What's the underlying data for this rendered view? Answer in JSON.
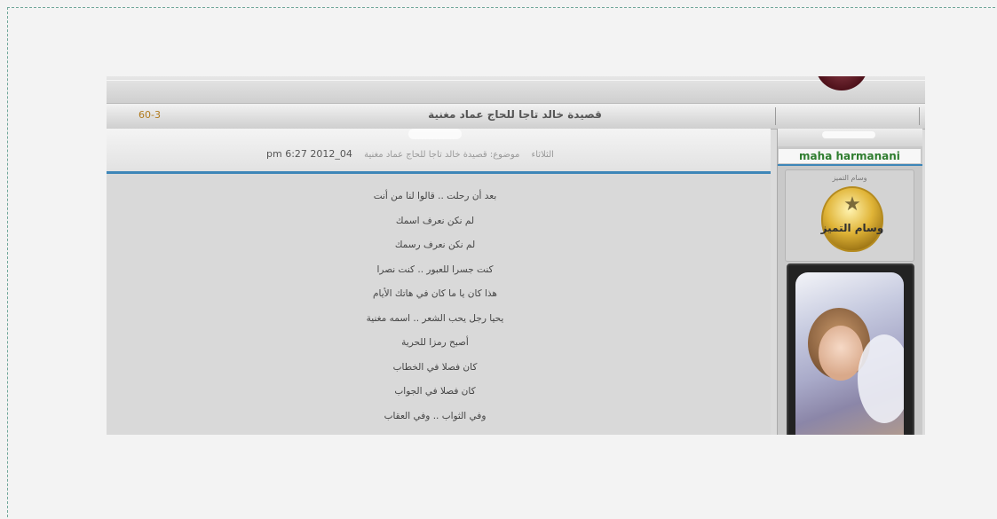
{
  "post": {
    "title": "قصيدة خالد تاجا للحاج عماد مغنية",
    "number": "60-3",
    "meta_subject": "موضوع: قصيدة خالد تاجا للحاج عماد مغنية",
    "meta_posted_in": "الثلاثاء",
    "meta_date": "pm 6:27 2012_04"
  },
  "poem": {
    "lines": [
      "بعد أن رحلت .. قالوا لنا من أنت",
      "لم نكن نعرف اسمك",
      "لم نكن نعرف رسمك",
      "كنت جسرا للعبور .. كنت نصرا",
      "هذا كان يا ما كان في هاتك الأيام",
      "يحيا رجل يحب الشعر .. اسمه مغنية",
      "أصبح رمزا للحرية",
      "كان فصلا في الخطاب",
      "كان فصلا في الجواب",
      "وفي الثواب .. وفي العقاب"
    ]
  },
  "sidebar": {
    "username": "maha harmanani",
    "rank_label": "وسام التميز",
    "badge_text": "وسام التميز",
    "badge_icon": "star-icon",
    "avatar_icon": "angel-avatar"
  },
  "colors": {
    "accent_blue": "#3d86b8",
    "username_green": "#2f7d2f",
    "badge_gold": "#e0b437",
    "emblem_maroon": "#4b0f18"
  }
}
